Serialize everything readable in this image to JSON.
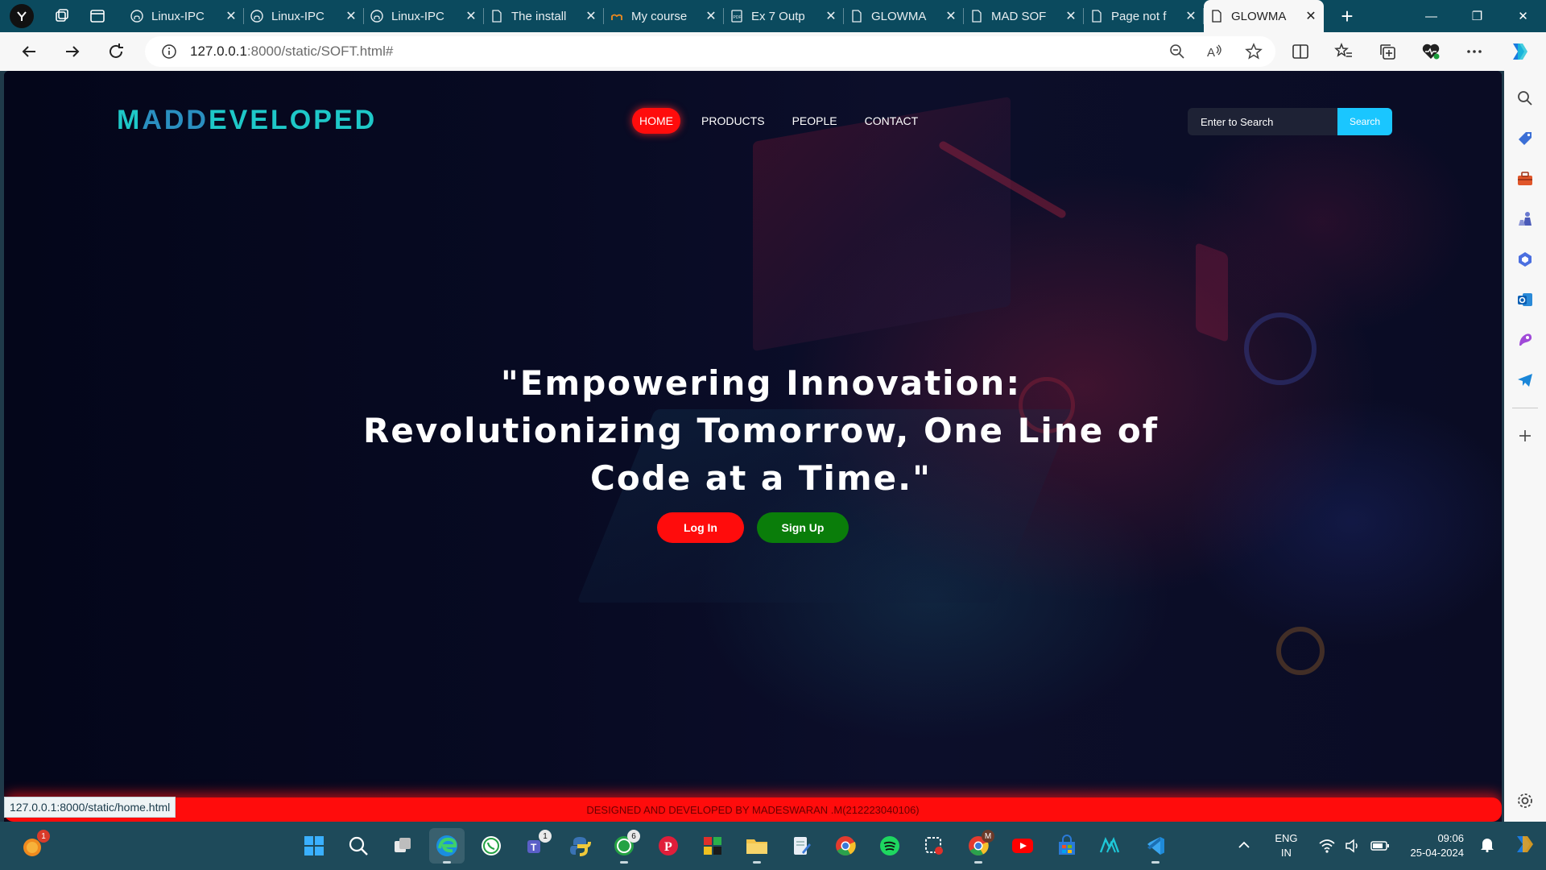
{
  "browser": {
    "tabs": [
      {
        "title": "Linux-IPC",
        "icon": "github-icon"
      },
      {
        "title": "Linux-IPC",
        "icon": "github-icon"
      },
      {
        "title": "Linux-IPC",
        "icon": "github-icon"
      },
      {
        "title": "The install",
        "icon": "page-icon"
      },
      {
        "title": "My course",
        "icon": "moodle-icon"
      },
      {
        "title": "Ex 7 Outp",
        "icon": "pdf-icon"
      },
      {
        "title": "GLOWMA",
        "icon": "page-icon"
      },
      {
        "title": "MAD SOF",
        "icon": "page-icon"
      },
      {
        "title": "Page not f",
        "icon": "page-icon"
      },
      {
        "title": "GLOWMA",
        "icon": "page-icon",
        "active": true
      }
    ],
    "address": {
      "host": "127.0.0.1",
      "path": ":8000/static/SOFT.html#"
    },
    "status_url": "127.0.0.1:8000/static/home.html"
  },
  "site": {
    "logo": {
      "part1": "M",
      "part2": "ADD",
      "part3": "EVELOPED"
    },
    "nav": [
      {
        "label": "HOME",
        "active": true
      },
      {
        "label": "PRODUCTS"
      },
      {
        "label": "PEOPLE"
      },
      {
        "label": "CONTACT"
      }
    ],
    "search": {
      "placeholder": "Enter to Search",
      "button": "Search"
    },
    "headline": "\"Empowering Innovation: Revolutionizing Tomorrow, One Line of Code at a Time.\"",
    "buttons": {
      "login": "Log In",
      "signup": "Sign Up"
    },
    "footer": "DESIGNED AND DEVELOPED BY MADESWARAN .M(212223040106)"
  },
  "taskbar": {
    "weather_badge": "1",
    "teams_badge": "1",
    "whatsapp_badge": "6",
    "gmail_badge": "M",
    "lang": {
      "line1": "ENG",
      "line2": "IN"
    },
    "clock": {
      "time": "09:06",
      "date": "25-04-2024"
    }
  },
  "colors": {
    "accent_red": "#ff0c0c",
    "accent_cyan": "#1ac6ff",
    "signup_green": "#0a7d0a",
    "logo_teal": "#1ec8c8",
    "logo_blue": "#2a8fc0"
  }
}
